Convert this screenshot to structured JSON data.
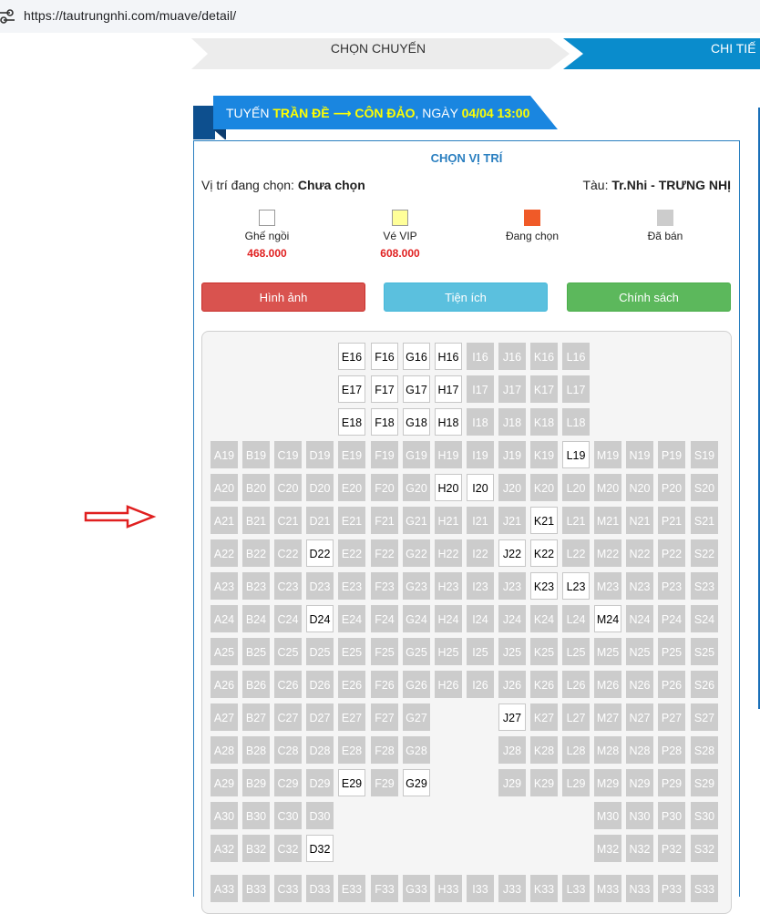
{
  "browser": {
    "url": "https://tautrungnhi.com/muave/detail/"
  },
  "steps": {
    "step1": "CHỌN CHUYẾN",
    "step2": "CHI TIẾ"
  },
  "route": {
    "prefix": "TUYẾN",
    "from_to": "TRẦN ĐỀ ⟶ CÔN ĐẢO",
    "mid": ", NGÀY",
    "datetime": "04/04 13:00"
  },
  "panel": {
    "title": "CHỌN VỊ TRÍ",
    "selected_label": "Vị trí đang chọn:",
    "selected_value": "Chưa chọn",
    "ship_label": "Tàu:",
    "ship_value": "Tr.Nhi - TRƯNG NHỊ"
  },
  "legend": [
    {
      "label": "Ghế ngồi",
      "price": "468.000",
      "color": "#ffffff"
    },
    {
      "label": "Vé VIP",
      "price": "608.000",
      "color": "#ffff99"
    },
    {
      "label": "Đang chọn",
      "price": "",
      "color": "#f05a28"
    },
    {
      "label": "Đã bán",
      "price": "",
      "color": "#cccccc"
    }
  ],
  "buttons": [
    {
      "label": "Hình ảnh",
      "color": "#d9534f"
    },
    {
      "label": "Tiện ích",
      "color": "#5bc0de"
    },
    {
      "label": "Chính sách",
      "color": "#5cb85c"
    }
  ],
  "colors": {
    "accent": "#0a7ec2",
    "sold": "#cccccc",
    "available": "#ffffff",
    "arrow": "#e02020"
  },
  "seat_columns": [
    "A",
    "B",
    "C",
    "D",
    "E",
    "F",
    "G",
    "H",
    "I",
    "J",
    "K",
    "L",
    "M",
    "N",
    "P",
    "S"
  ],
  "seat_rows": [
    {
      "num": "16",
      "cols": [
        "E",
        "F",
        "G",
        "H",
        "I",
        "J",
        "K",
        "L"
      ],
      "available": [
        "E",
        "F",
        "G",
        "H"
      ]
    },
    {
      "num": "17",
      "cols": [
        "E",
        "F",
        "G",
        "H",
        "I",
        "J",
        "K",
        "L"
      ],
      "available": [
        "E",
        "F",
        "G",
        "H"
      ]
    },
    {
      "num": "18",
      "cols": [
        "E",
        "F",
        "G",
        "H",
        "I",
        "J",
        "K",
        "L"
      ],
      "available": [
        "E",
        "F",
        "G",
        "H"
      ]
    },
    {
      "num": "19",
      "cols": [
        "A",
        "B",
        "C",
        "D",
        "E",
        "F",
        "G",
        "H",
        "I",
        "J",
        "K",
        "L",
        "M",
        "N",
        "P",
        "S"
      ],
      "available": [
        "L"
      ]
    },
    {
      "num": "20",
      "cols": [
        "A",
        "B",
        "C",
        "D",
        "E",
        "F",
        "G",
        "H",
        "I",
        "J",
        "K",
        "L",
        "M",
        "N",
        "P",
        "S"
      ],
      "available": [
        "H",
        "I"
      ]
    },
    {
      "num": "21",
      "cols": [
        "A",
        "B",
        "C",
        "D",
        "E",
        "F",
        "G",
        "H",
        "I",
        "J",
        "K",
        "L",
        "M",
        "N",
        "P",
        "S"
      ],
      "available": [
        "K"
      ]
    },
    {
      "num": "22",
      "cols": [
        "A",
        "B",
        "C",
        "D",
        "E",
        "F",
        "G",
        "H",
        "I",
        "J",
        "K",
        "L",
        "M",
        "N",
        "P",
        "S"
      ],
      "available": [
        "D",
        "J",
        "K"
      ]
    },
    {
      "num": "23",
      "cols": [
        "A",
        "B",
        "C",
        "D",
        "E",
        "F",
        "G",
        "H",
        "I",
        "J",
        "K",
        "L",
        "M",
        "N",
        "P",
        "S"
      ],
      "available": [
        "K",
        "L"
      ]
    },
    {
      "num": "24",
      "cols": [
        "A",
        "B",
        "C",
        "D",
        "E",
        "F",
        "G",
        "H",
        "I",
        "J",
        "K",
        "L",
        "M",
        "N",
        "P",
        "S"
      ],
      "available": [
        "D",
        "M"
      ]
    },
    {
      "num": "25",
      "cols": [
        "A",
        "B",
        "C",
        "D",
        "E",
        "F",
        "G",
        "H",
        "I",
        "J",
        "K",
        "L",
        "M",
        "N",
        "P",
        "S"
      ],
      "available": []
    },
    {
      "num": "26",
      "cols": [
        "A",
        "B",
        "C",
        "D",
        "E",
        "F",
        "G",
        "H",
        "I",
        "J",
        "K",
        "L",
        "M",
        "N",
        "P",
        "S"
      ],
      "available": []
    },
    {
      "num": "27",
      "cols": [
        "A",
        "B",
        "C",
        "D",
        "E",
        "F",
        "G",
        "J",
        "K",
        "L",
        "M",
        "N",
        "P",
        "S"
      ],
      "available": [
        "J"
      ]
    },
    {
      "num": "28",
      "cols": [
        "A",
        "B",
        "C",
        "D",
        "E",
        "F",
        "G",
        "J",
        "K",
        "L",
        "M",
        "N",
        "P",
        "S"
      ],
      "available": []
    },
    {
      "num": "29",
      "cols": [
        "A",
        "B",
        "C",
        "D",
        "E",
        "F",
        "G",
        "J",
        "K",
        "L",
        "M",
        "N",
        "P",
        "S"
      ],
      "available": [
        "E",
        "G"
      ]
    },
    {
      "num": "30",
      "cols": [
        "A",
        "B",
        "C",
        "D",
        "M",
        "N",
        "P",
        "S"
      ],
      "available": []
    },
    {
      "num": "32",
      "cols": [
        "A",
        "B",
        "C",
        "D",
        "M",
        "N",
        "P",
        "S"
      ],
      "available": [
        "D"
      ]
    },
    {
      "num": "33",
      "cols": [
        "A",
        "B",
        "C",
        "D",
        "E",
        "F",
        "G",
        "H",
        "I",
        "J",
        "K",
        "L",
        "M",
        "N",
        "P",
        "S"
      ],
      "available": []
    }
  ]
}
